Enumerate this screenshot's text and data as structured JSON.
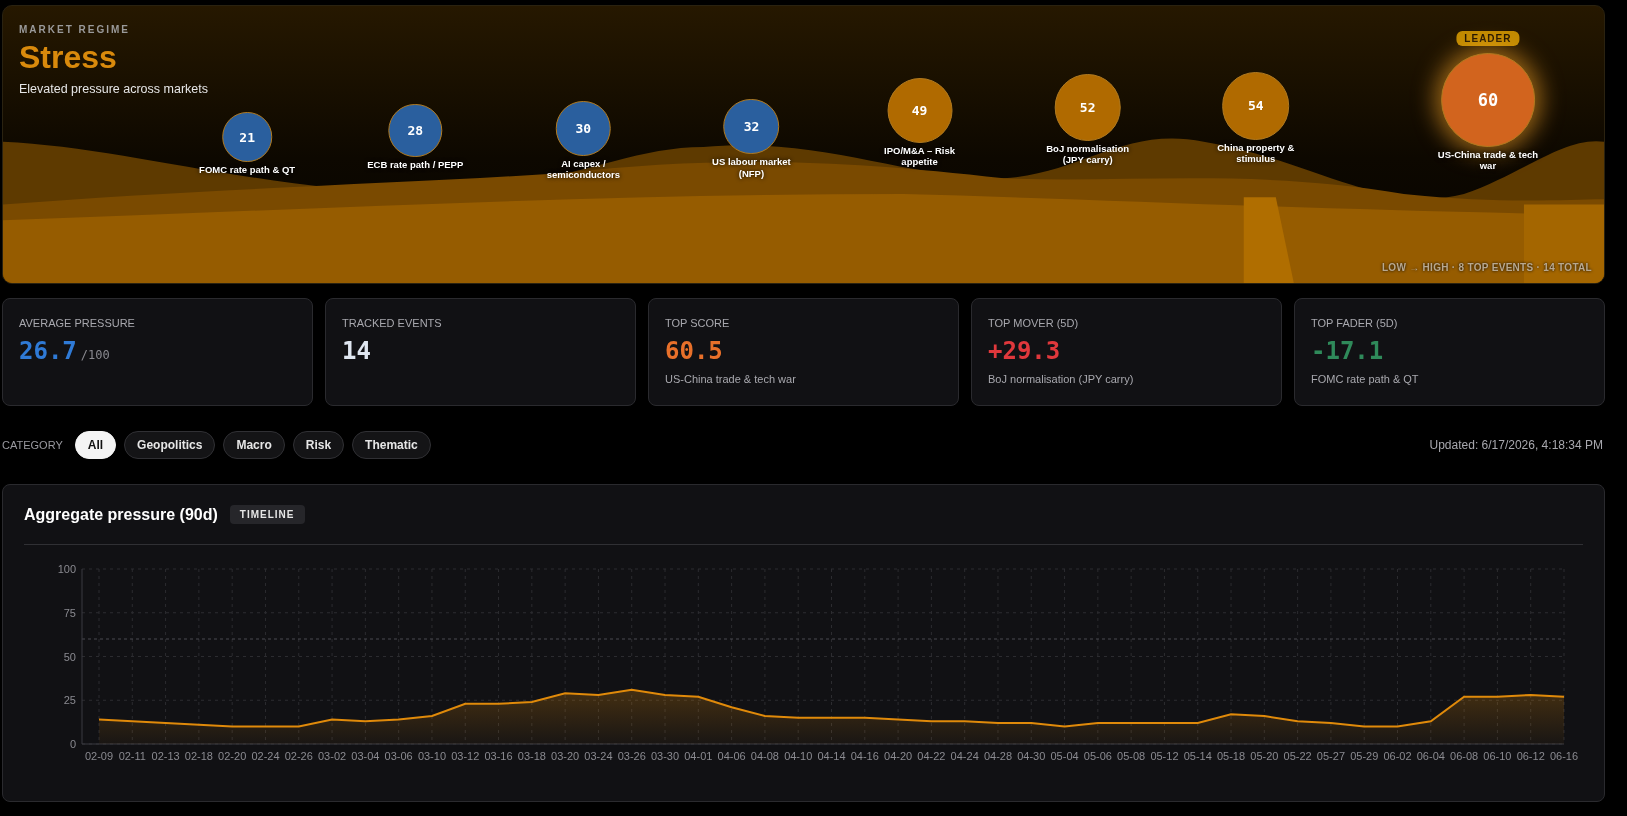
{
  "regime": {
    "eyebrow": "MARKET REGIME",
    "title": "Stress",
    "subtitle": "Elevated pressure across markets",
    "legend": "LOW → HIGH · 8 TOP EVENTS · 14 TOTAL",
    "events": [
      {
        "score": "21",
        "label": "FOMC rate path & QT",
        "color": "#2a5f9e",
        "leader": false
      },
      {
        "score": "28",
        "label": "ECB rate path / PEPP",
        "color": "#2a5f9e",
        "leader": false
      },
      {
        "score": "30",
        "label": "AI capex / semiconductors",
        "color": "#2a5f9e",
        "leader": false
      },
      {
        "score": "32",
        "label": "US labour market (NFP)",
        "color": "#2a5f9e",
        "leader": false
      },
      {
        "score": "49",
        "label": "IPO/M&A – Risk appetite",
        "color": "#b06a00",
        "leader": false
      },
      {
        "score": "52",
        "label": "BoJ normalisation (JPY carry)",
        "color": "#b06a00",
        "leader": false
      },
      {
        "score": "54",
        "label": "China property & stimulus",
        "color": "#b06a00",
        "leader": false
      },
      {
        "score": "60",
        "label": "US-China trade & tech war",
        "color": "#d2641e",
        "leader": true,
        "badge": "LEADER"
      }
    ]
  },
  "stats": [
    {
      "label": "AVERAGE PRESSURE",
      "value": "26.7",
      "unit": "/100",
      "color": "#2f7ad6"
    },
    {
      "label": "TRACKED EVENTS",
      "value": "14",
      "color": "#dfe6f0"
    },
    {
      "label": "TOP SCORE",
      "value": "60.5",
      "sub": "US-China trade & tech war",
      "color": "#e8702a"
    },
    {
      "label": "TOP MOVER (5D)",
      "value": "+29.3",
      "sub": "BoJ normalisation (JPY carry)",
      "color": "#e0383c"
    },
    {
      "label": "TOP FADER (5D)",
      "value": "-17.1",
      "sub": "FOMC rate path & QT",
      "color": "#2f8a5a"
    }
  ],
  "filters": {
    "label": "CATEGORY",
    "chips": [
      {
        "label": "All",
        "selected": true
      },
      {
        "label": "Geopolitics",
        "selected": false
      },
      {
        "label": "Macro",
        "selected": false
      },
      {
        "label": "Risk",
        "selected": false
      },
      {
        "label": "Thematic",
        "selected": false
      }
    ],
    "updated": "Updated: 6/17/2026, 4:18:34 PM"
  },
  "panel": {
    "title": "Aggregate pressure (90d)",
    "tag": "TIMELINE",
    "chart_data": {
      "type": "area",
      "ylim": [
        0,
        100
      ],
      "yticks": [
        0,
        25,
        50,
        75,
        100
      ],
      "categories": [
        "02-09",
        "02-11",
        "02-13",
        "02-18",
        "02-20",
        "02-24",
        "02-26",
        "03-02",
        "03-04",
        "03-06",
        "03-10",
        "03-12",
        "03-16",
        "03-18",
        "03-20",
        "03-24",
        "03-26",
        "03-30",
        "04-01",
        "04-06",
        "04-08",
        "04-10",
        "04-14",
        "04-16",
        "04-20",
        "04-22",
        "04-24",
        "04-28",
        "04-30",
        "05-04",
        "05-06",
        "05-08",
        "05-12",
        "05-14",
        "05-18",
        "05-20",
        "05-22",
        "05-27",
        "05-29",
        "06-02",
        "06-04",
        "06-08",
        "06-10",
        "06-12",
        "06-16"
      ],
      "grid": true,
      "series": [
        {
          "color": "#e08a0a",
          "values": [
            14,
            13,
            12,
            11,
            10,
            10,
            10,
            14,
            13,
            14,
            16,
            23,
            23,
            24,
            29,
            28,
            31,
            28,
            27,
            21,
            16,
            15,
            15,
            15,
            14,
            13,
            13,
            12,
            12,
            10,
            12,
            12,
            12,
            12,
            17,
            16,
            13,
            12,
            10,
            10,
            13,
            27,
            27,
            28,
            27
          ]
        }
      ],
      "ref_lines": [
        {
          "axis": "y",
          "value": 60
        }
      ]
    }
  }
}
